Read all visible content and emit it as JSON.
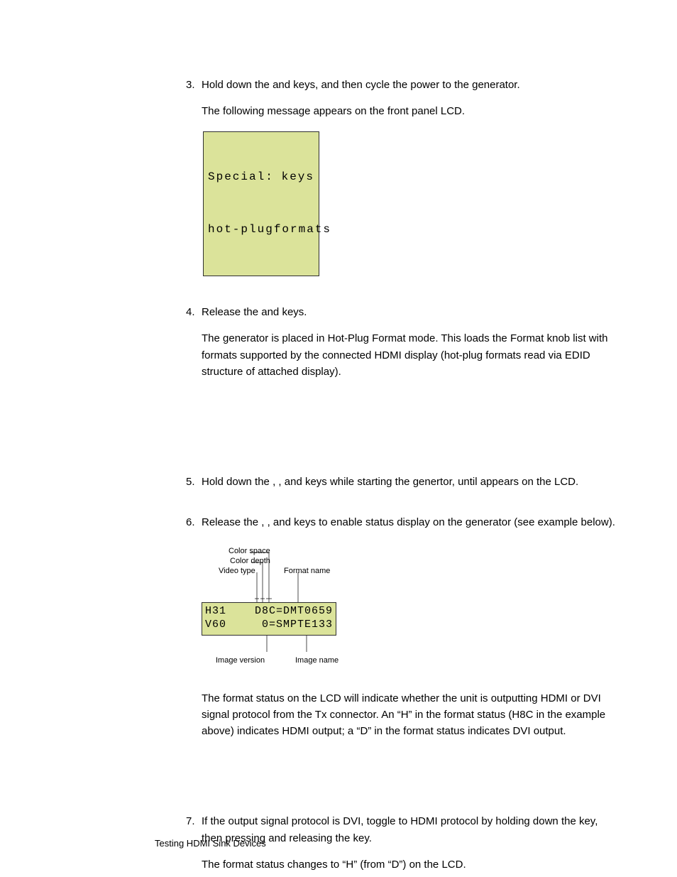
{
  "steps": {
    "s3": {
      "num": "3.",
      "line1a": "Hold down the ",
      "line1b": " and ",
      "line1c": " keys, and then cycle the power to the generator.",
      "line2": "The following message appears on the front panel LCD.",
      "lcd_row1_left": "Special:",
      "lcd_row1_right": "keys",
      "lcd_row2_left": "hot-plug",
      "lcd_row2_right": "formats"
    },
    "s4": {
      "num": "4.",
      "line1a": "Release the ",
      "line1b": " and ",
      "line1c": " keys.",
      "para": "The generator is placed in Hot-Plug Format mode. This loads the Format knob list with formats supported by the connected HDMI display (hot-plug formats read via EDID structure of attached display)."
    },
    "s5": {
      "num": "5.",
      "line1a": "Hold down the ",
      "line1b": " , ",
      "line1c": " , and ",
      "line1d": " keys while starting the genertor, until ",
      "line1e": "appears on the LCD."
    },
    "s6": {
      "num": "6.",
      "line1a": "Release the ",
      "line1b": " , ",
      "line1c": " , and ",
      "line1d": " keys to enable status display on the generator (see example below).",
      "labels": {
        "color_space": "Color space",
        "color_depth": "Color depth",
        "video_type": "Video type",
        "format_name": "Format name",
        "image_version": "Image version",
        "image_name": "Image name"
      },
      "lcd_row1_left": "H31",
      "lcd_row1_right": "D8C=DMT0659",
      "lcd_row2_left": "V60",
      "lcd_row2_right": "0=SMPTE133",
      "para": "The format status on the LCD will indicate whether the unit is outputting HDMI or DVI signal protocol from the Tx connector. An “H” in the format status (H8C in the example above) indicates HDMI output; a “D” in the format status indicates DVI output."
    },
    "s7": {
      "num": "7.",
      "line1a": "If the output signal protocol is DVI, toggle to HDMI protocol by holding down the ",
      "line1b": " key, then pressing and releasing the ",
      "line1c": " key.",
      "line2": "The format status changes to “H” (from “D”) on the LCD."
    }
  },
  "footer": "Testing HDMI Sink Devices"
}
